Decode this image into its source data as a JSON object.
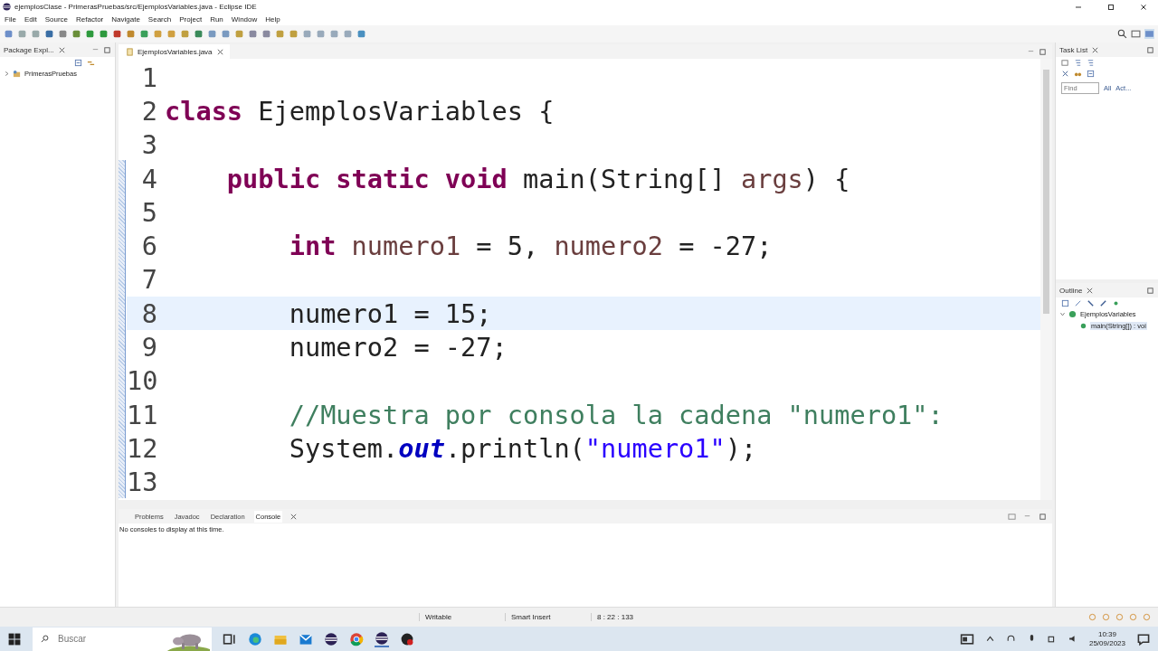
{
  "window": {
    "title": "ejemplosClase - PrimerasPruebas/src/EjemplosVariables.java - Eclipse IDE"
  },
  "menu": [
    "File",
    "Edit",
    "Source",
    "Refactor",
    "Navigate",
    "Search",
    "Project",
    "Run",
    "Window",
    "Help"
  ],
  "package_explorer": {
    "title": "Package Expl...",
    "tree": [
      {
        "label": "PrimerasPruebas",
        "expanded": false,
        "selected": false
      }
    ]
  },
  "editor": {
    "tabs": [
      {
        "label": "EjemplosVariables.java",
        "selected": true
      }
    ],
    "lines": [
      {
        "number": "1",
        "current": false
      },
      {
        "number": "2",
        "current": false,
        "tokens": [
          {
            "kind": "kw",
            "text": "class"
          },
          {
            "kind": "plain",
            "text": " EjemplosVariables {"
          }
        ]
      },
      {
        "number": "3",
        "current": false
      },
      {
        "number": "4",
        "current": false,
        "tokens": [
          {
            "kind": "kw",
            "text": "    public static void"
          },
          {
            "kind": "plain",
            "text": " main(String[] "
          },
          {
            "kind": "var",
            "text": "args"
          },
          {
            "kind": "plain",
            "text": ") {"
          }
        ]
      },
      {
        "number": "5",
        "current": false
      },
      {
        "number": "6",
        "current": false,
        "tokens": [
          {
            "kind": "kw",
            "text": "        int "
          },
          {
            "kind": "var",
            "text": "numero1"
          },
          {
            "kind": "plain",
            "text": " = 5, "
          },
          {
            "kind": "var",
            "text": "numero2"
          },
          {
            "kind": "plain",
            "text": " = -27;"
          }
        ]
      },
      {
        "number": "7",
        "current": false
      },
      {
        "number": "8",
        "current": true,
        "tokens": [
          {
            "kind": "plain",
            "text": "        numero1 = 15;"
          }
        ]
      },
      {
        "number": "9",
        "current": false,
        "tokens": [
          {
            "kind": "plain",
            "text": "        numero2 = -27;"
          }
        ]
      },
      {
        "number": "10",
        "current": false
      },
      {
        "number": "11",
        "current": false,
        "tokens": [
          {
            "kind": "comment",
            "text": "        //Muestra por consola la cadena \"numero1\":"
          }
        ]
      },
      {
        "number": "12",
        "current": false,
        "tokens": [
          {
            "kind": "plain",
            "text": "        System."
          },
          {
            "kind": "field",
            "text": "out"
          },
          {
            "kind": "plain",
            "text": ".println("
          },
          {
            "kind": "str",
            "text": "\"numero1\""
          },
          {
            "kind": "plain",
            "text": ");"
          }
        ]
      },
      {
        "number": "13",
        "current": false
      }
    ]
  },
  "task_list": {
    "title": "Task List",
    "find_placeholder": "Find",
    "filters": [
      "All",
      "Act..."
    ]
  },
  "outline": {
    "title": "Outline",
    "tree": [
      {
        "label": "EjemplosVariables",
        "expanded": true,
        "selected": false,
        "children": [
          {
            "label": "main(String[]) : voi",
            "selected": true
          }
        ]
      }
    ]
  },
  "console": {
    "tabs": [
      {
        "label": "Problems",
        "selected": false
      },
      {
        "label": "Javadoc",
        "selected": false
      },
      {
        "label": "Declaration",
        "selected": false
      },
      {
        "label": "Console",
        "selected": true
      }
    ],
    "message": "No consoles to display at this time."
  },
  "status_bar": [
    "Writable",
    "Smart Insert",
    "8 : 22 : 133"
  ],
  "taskbar": {
    "search_placeholder": "Buscar",
    "time": "10:39",
    "date": "25/09/2023"
  }
}
